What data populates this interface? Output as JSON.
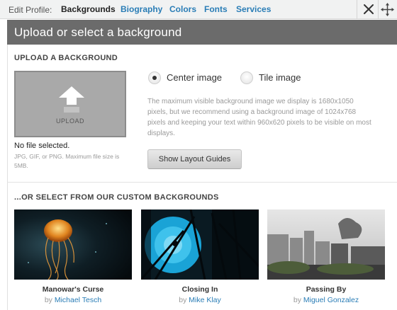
{
  "nav": {
    "label": "Edit Profile:",
    "items": [
      "Backgrounds",
      "Biography",
      "Colors",
      "Fonts",
      "Services"
    ],
    "active": "Backgrounds",
    "close_icon": "close-icon",
    "move_icon": "move-icon"
  },
  "header": {
    "title": "Upload or select a background"
  },
  "upload": {
    "section_title": "UPLOAD A BACKGROUND",
    "button_label": "UPLOAD",
    "status": "No file selected.",
    "hint": "JPG, GIF, or PNG. Maximum file size is 5MB."
  },
  "options": {
    "center_label": "Center image",
    "tile_label": "Tile image",
    "selected": "center",
    "description": "The maximum visible background image we display is 1680x1050 pixels, but we recommend using a background image of 1024x768 pixels and keeping your text within 960x620 pixels to be visible on most displays.",
    "layout_button": "Show Layout Guides"
  },
  "custom": {
    "section_title": "...OR SELECT FROM OUR CUSTOM BACKGROUNDS",
    "by_label": "by",
    "items": [
      {
        "title": "Manowar's Curse",
        "author": "Michael Tesch"
      },
      {
        "title": "Closing In",
        "author": "Mike Klay"
      },
      {
        "title": "Passing By",
        "author": "Miguel Gonzalez"
      }
    ]
  },
  "colors": {
    "link": "#2a7db6",
    "header_bg": "#6b6b6b",
    "topbar_bg": "#f1f2f2"
  }
}
